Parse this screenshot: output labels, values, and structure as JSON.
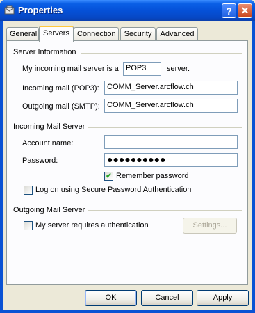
{
  "window": {
    "title": "Properties",
    "help_glyph": "?",
    "close_glyph": "✕"
  },
  "tabs": [
    {
      "label": "General"
    },
    {
      "label": "Servers"
    },
    {
      "label": "Connection"
    },
    {
      "label": "Security"
    },
    {
      "label": "Advanced"
    }
  ],
  "active_tab": "Servers",
  "server_info": {
    "group_label": "Server Information",
    "incoming_type_prefix": "My incoming mail server is a",
    "incoming_type_value": "POP3",
    "incoming_type_suffix": "server.",
    "incoming_label": "Incoming mail (POP3):",
    "incoming_value": "COMM_Server.arcflow.ch",
    "outgoing_label": "Outgoing mail (SMTP):",
    "outgoing_value": "COMM_Server.arcflow.ch"
  },
  "incoming_server": {
    "group_label": "Incoming Mail Server",
    "account_label": "Account name:",
    "account_value": "",
    "password_label": "Password:",
    "password_value": "●●●●●●●●●●",
    "remember_label": "Remember password",
    "remember_checked": true,
    "spa_label": "Log on using Secure Password Authentication",
    "spa_checked": false
  },
  "outgoing_server": {
    "group_label": "Outgoing Mail Server",
    "auth_label": "My server requires authentication",
    "auth_checked": false,
    "settings_label": "Settings..."
  },
  "buttons": {
    "ok": "OK",
    "cancel": "Cancel",
    "apply": "Apply"
  },
  "check_glyph": "✔",
  "colors": {
    "titlebar": "#0551d8",
    "tab_highlight": "#ffc83c",
    "check": "#21a121"
  }
}
